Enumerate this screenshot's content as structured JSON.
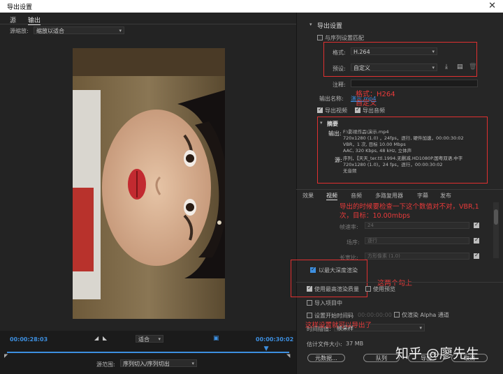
{
  "window": {
    "title": "导出设置",
    "close_glyph": "✕"
  },
  "left": {
    "tabs": [
      "源",
      "输出"
    ],
    "source_scale_label": "源缩放:",
    "source_scale_value": "缩放以适合",
    "current_time": "00:00:28:03",
    "fit_value": "适合",
    "end_time": "00:00:30:02",
    "source_range_label": "源范围:",
    "source_range_value": "序列切入/序列切出",
    "playhead_fraction": 0.92
  },
  "export": {
    "section_title": "导出设置",
    "match_sequence": "与序列设置匹配",
    "format_label": "格式:",
    "format_value": "H.264",
    "preset_label": "预设:",
    "preset_value": "自定义",
    "comment_label": "注释:",
    "output_name_label": "输出名称:",
    "output_name_value": "演示.mp4",
    "export_video": "导出视频",
    "export_audio": "导出音频",
    "annot_format": "格式：H264",
    "annot_preset": "自定义"
  },
  "summary": {
    "title": "摘要",
    "output_label": "输出:",
    "output_lines": [
      "F:\\影视作品\\演示.mp4",
      "720x1280 (1.0) ，24fps，逐行, 硬件加速，00:00:30:02",
      "VBR，1 次, 目标 10.00 Mbps",
      "AAC, 320 Kbps, 48 kHz, 立体声"
    ],
    "source_label": "源:",
    "source_lines": [
      "序列，【天天_ter.ttl.1994.无删减.HD1080P.国粤双语.中字",
      "720x1280 (1.0)，24 fps，逐行，00:00:30:02",
      "无音频"
    ]
  },
  "tabs2": [
    "效果",
    "视频",
    "音频",
    "多路复用器",
    "字幕",
    "发布"
  ],
  "video_settings": {
    "annot_check": "导出的时候要检查一下这个数值对不对，VBR,1次，目标：10.00mbps",
    "frame_rate_label": "帧速率:",
    "frame_rate_value": "24",
    "field_order_label": "场序:",
    "field_order_value": "逐行",
    "aspect_label": "长宽比:",
    "aspect_value": "方形像素 (1.0)",
    "max_depth": "以最大深度渲染",
    "annot_both": "这两个勾上"
  },
  "bottom": {
    "use_max_quality": "使用最高渲染质量",
    "use_previews": "使用预览",
    "import_into_project": "导入项目中",
    "set_start_timecode": "设置开始时间码",
    "start_timecode_value": "00:00:00:00",
    "render_alpha": "仅渲染 Alpha 通道",
    "time_interp_label": "时间插值:",
    "time_interp_value": "帧采样",
    "annot_export": "这样设置就可以导出了",
    "file_size_label": "估计文件大小:",
    "file_size_value": "37 MB",
    "metadata_button": "元数据...",
    "queue_button": "队列",
    "export_button": "导出",
    "cancel_button": "取消",
    "watermark": "知乎 @廖先生"
  }
}
